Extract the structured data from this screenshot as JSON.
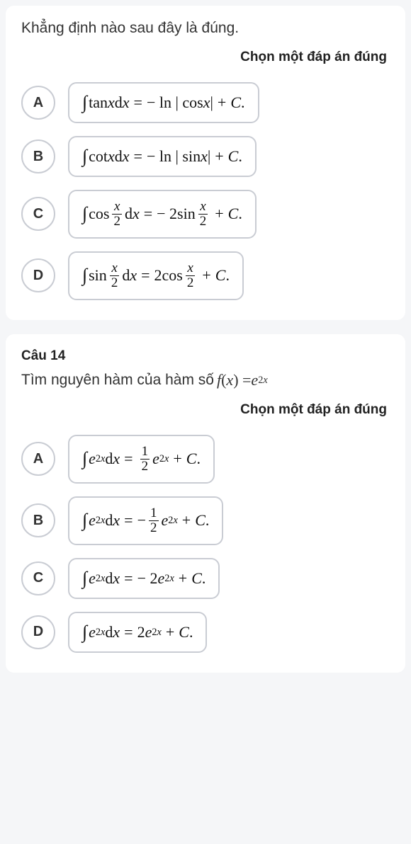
{
  "q13": {
    "question": "Khẳng định nào sau đây là đúng.",
    "prompt": "Chọn một đáp án đúng",
    "letters": {
      "a": "A",
      "b": "B",
      "c": "C",
      "d": "D"
    }
  },
  "q14": {
    "number": "Câu 14",
    "question_prefix": "Tìm nguyên hàm của hàm số ",
    "prompt": "Chọn một đáp án đúng",
    "letters": {
      "a": "A",
      "b": "B",
      "c": "C",
      "d": "D"
    }
  },
  "chart_data": {
    "type": "table",
    "questions": [
      {
        "id": 13,
        "text": "Khẳng định nào sau đây là đúng.",
        "options": [
          {
            "label": "A",
            "latex": "\\int \\tan x\\,dx = -\\ln|\\cos x| + C."
          },
          {
            "label": "B",
            "latex": "\\int \\cot x\\,dx = -\\ln|\\sin x| + C."
          },
          {
            "label": "C",
            "latex": "\\int \\cos\\frac{x}{2}\\,dx = -2\\sin\\frac{x}{2} + C."
          },
          {
            "label": "D",
            "latex": "\\int \\sin\\frac{x}{2}\\,dx = 2\\cos\\frac{x}{2} + C."
          }
        ]
      },
      {
        "id": 14,
        "text": "Tìm nguyên hàm của hàm số f(x) = e^{2x}",
        "options": [
          {
            "label": "A",
            "latex": "\\int e^{2x}\\,dx = \\frac{1}{2} e^{2x} + C."
          },
          {
            "label": "B",
            "latex": "\\int e^{2x}\\,dx = -\\frac{1}{2} e^{2x} + C."
          },
          {
            "label": "C",
            "latex": "\\int e^{2x}\\,dx = -2 e^{2x} + C."
          },
          {
            "label": "D",
            "latex": "\\int e^{2x}\\,dx = 2 e^{2x} + C."
          }
        ]
      }
    ]
  }
}
